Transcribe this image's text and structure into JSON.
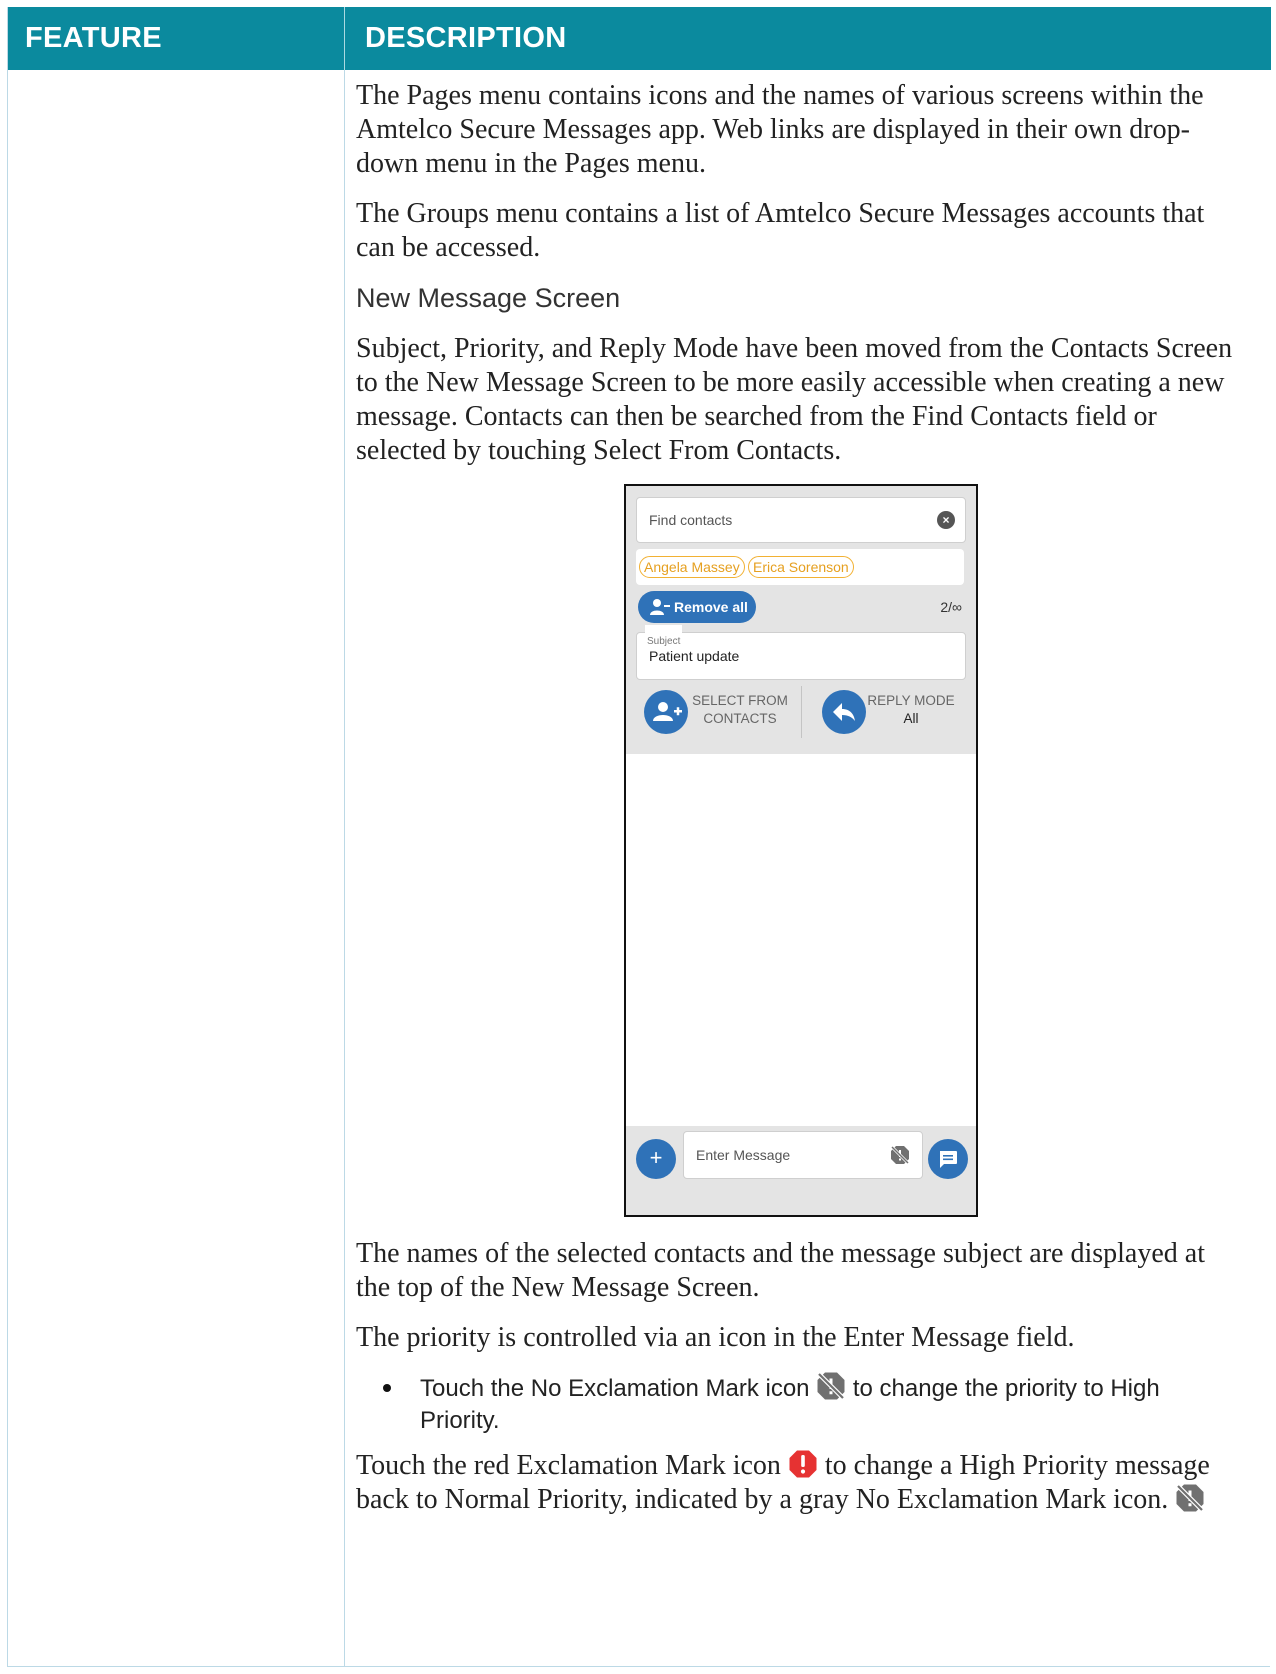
{
  "table": {
    "header": {
      "feature": "FEATURE",
      "description": "DESCRIPTION"
    }
  },
  "description": {
    "para1": "The Pages menu contains icons and the names of various screens within the Amtelco Secure Messages app. Web links are displayed in their own drop-down menu in the Pages menu.",
    "para2": "The Groups menu contains a list of Amtelco Secure Messages accounts that can be accessed.",
    "subheading": "New Message Screen",
    "para3": "Subject, Priority, and Reply Mode have been moved from the Contacts Screen to the New Message Screen to be more easily accessible when creating a new message. Contacts can then be searched from the Find Contacts field or selected by touching Select From Contacts.",
    "para4": "The names of the selected contacts and the message subject are displayed at the top of the New Message Screen.",
    "para5": "The priority is controlled via an icon in the Enter Message field.",
    "bullet1_before": "Touch the No Exclamation Mark icon ",
    "bullet1_after": " to change the priority to High Priority.",
    "para6_before": "Touch the red Exclamation Mark icon ",
    "para6_after": " to change a High Priority message back to Normal Priority, indicated by a gray No Exclamation Mark icon. "
  },
  "phone": {
    "find_placeholder": "Find contacts",
    "chips": [
      "Angela Massey",
      "Erica Sorenson"
    ],
    "remove_all_label": "Remove all",
    "count": "2/∞",
    "subject_label": "Subject",
    "subject_value": "Patient update",
    "select_from_contacts_line1": "SELECT FROM",
    "select_from_contacts_line2": "CONTACTS",
    "reply_mode_label": "REPLY MODE",
    "reply_mode_value": "All",
    "add_symbol": "+",
    "enter_message_placeholder": "Enter Message"
  },
  "colors": {
    "header_bg": "#0b8a9e",
    "app_blue": "#2f72b8",
    "chip_orange": "#f2b133",
    "priority_red": "#e63232",
    "icon_gray": "#707070"
  },
  "icons": {
    "clear": "close-circle-icon",
    "remove_all": "remove-users-icon",
    "select_from_contacts": "add-user-icon",
    "reply_mode": "reply-icon",
    "add": "plus-icon",
    "priority_off": "no-exclamation-mark-icon",
    "priority_high": "exclamation-mark-icon",
    "send": "message-icon"
  }
}
